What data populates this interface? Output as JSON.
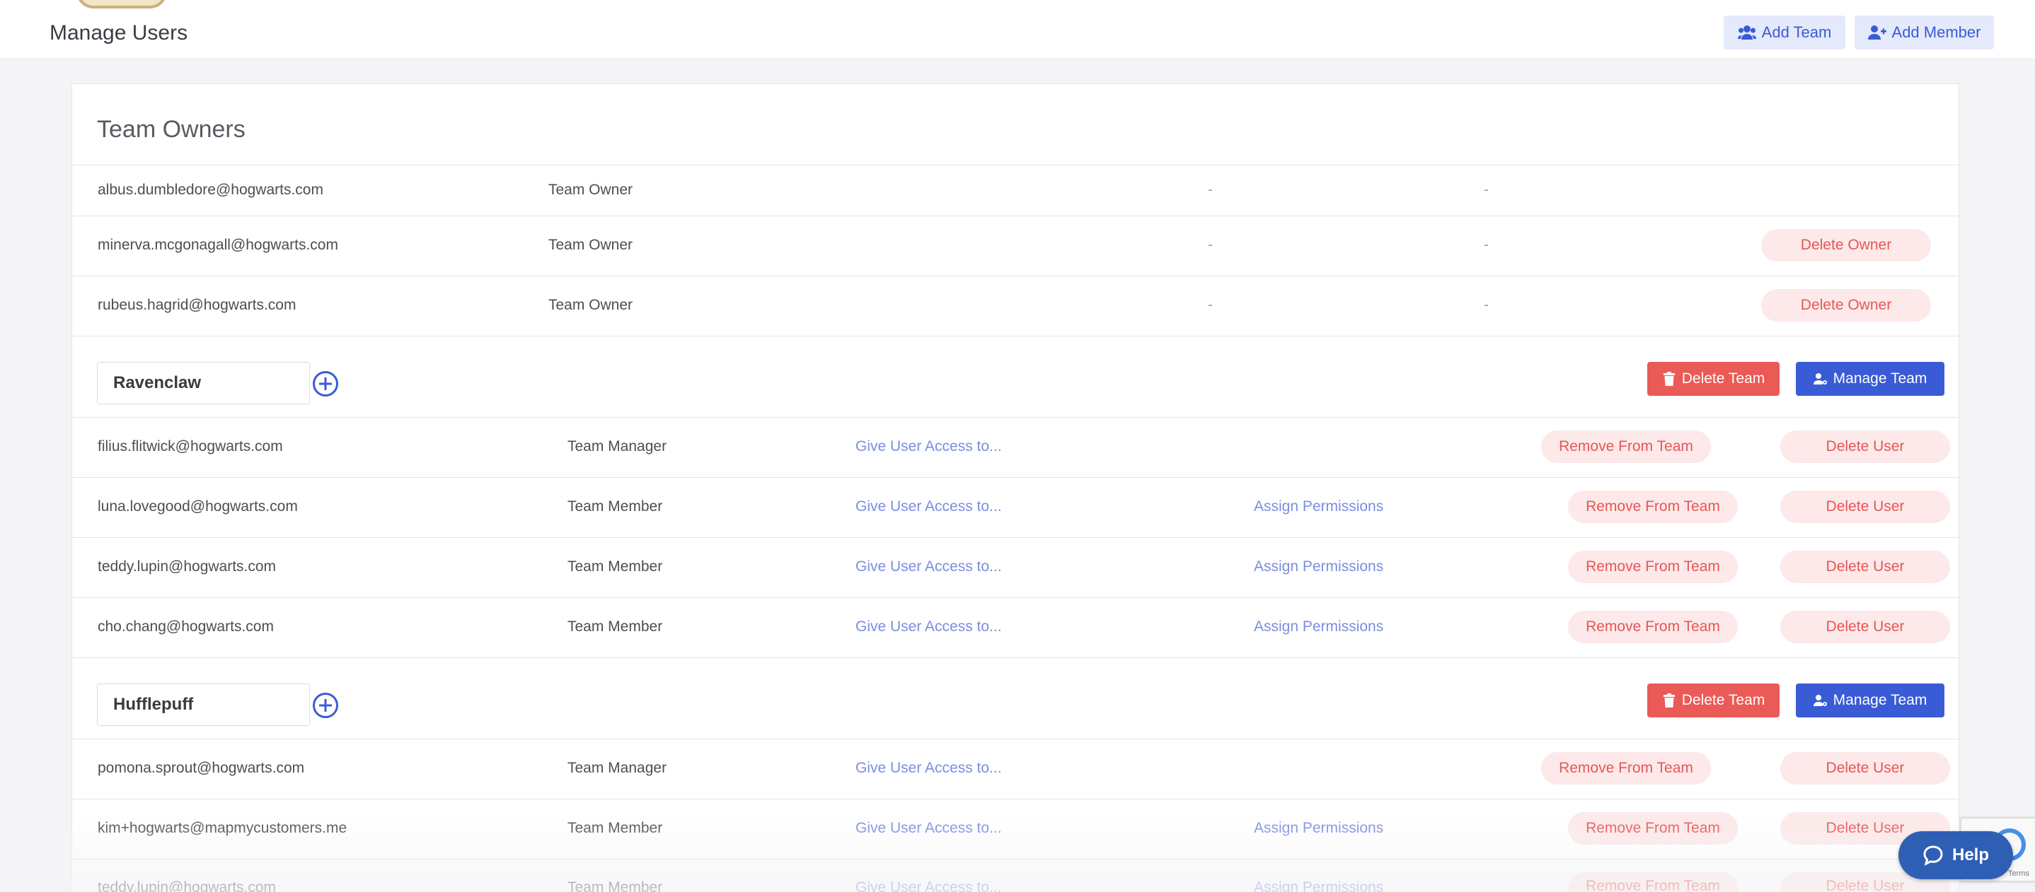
{
  "header": {
    "title": "Manage Users",
    "add_team_label": "Add Team",
    "add_member_label": "Add Member"
  },
  "owners_section": {
    "title": "Team Owners",
    "rows": [
      {
        "email": "albus.dumbledore@hogwarts.com",
        "role": "Team Owner",
        "col3": "-",
        "col4": "-",
        "action": ""
      },
      {
        "email": "minerva.mcgonagall@hogwarts.com",
        "role": "Team Owner",
        "col3": "-",
        "col4": "-",
        "action": "Delete Owner"
      },
      {
        "email": "rubeus.hagrid@hogwarts.com",
        "role": "Team Owner",
        "col3": "-",
        "col4": "-",
        "action": "Delete Owner"
      }
    ]
  },
  "teams": [
    {
      "name": "Ravenclaw",
      "delete_team_label": "Delete Team",
      "manage_team_label": "Manage Team",
      "members": [
        {
          "email": "filius.flitwick@hogwarts.com",
          "role": "Team Manager",
          "access": "Give User Access to...",
          "permissions": "",
          "remove": "Remove From Team",
          "delete": "Delete User"
        },
        {
          "email": "luna.lovegood@hogwarts.com",
          "role": "Team Member",
          "access": "Give User Access to...",
          "permissions": "Assign Permissions",
          "remove": "Remove From Team",
          "delete": "Delete User"
        },
        {
          "email": "teddy.lupin@hogwarts.com",
          "role": "Team Member",
          "access": "Give User Access to...",
          "permissions": "Assign Permissions",
          "remove": "Remove From Team",
          "delete": "Delete User"
        },
        {
          "email": "cho.chang@hogwarts.com",
          "role": "Team Member",
          "access": "Give User Access to...",
          "permissions": "Assign Permissions",
          "remove": "Remove From Team",
          "delete": "Delete User"
        }
      ]
    },
    {
      "name": "Hufflepuff",
      "delete_team_label": "Delete Team",
      "manage_team_label": "Manage Team",
      "members": [
        {
          "email": "pomona.sprout@hogwarts.com",
          "role": "Team Manager",
          "access": "Give User Access to...",
          "permissions": "",
          "remove": "Remove From Team",
          "delete": "Delete User"
        },
        {
          "email": "kim+hogwarts@mapmycustomers.me",
          "role": "Team Member",
          "access": "Give User Access to...",
          "permissions": "Assign Permissions",
          "remove": "Remove From Team",
          "delete": "Delete User"
        },
        {
          "email": "teddy.lupin@hogwarts.com",
          "role": "Team Member",
          "access": "Give User Access to...",
          "permissions": "Assign Permissions",
          "remove": "Remove From Team",
          "delete": "Delete User"
        }
      ]
    }
  ],
  "help_widget": {
    "label": "Help"
  },
  "recaptcha": {
    "text": "Terms"
  },
  "colors": {
    "accent": "#3a5bd6",
    "danger": "#ea5a56",
    "danger_soft": "#fde9e9",
    "link": "#7a8ee0",
    "help": "#2f5fb4"
  },
  "icons": {
    "add_team": "users-icon",
    "add_member": "user-plus-icon",
    "delete_team": "trash-icon",
    "manage_team": "users-cog-icon",
    "add_to_team": "plus-circle-icon",
    "help": "chat-bubble-icon"
  }
}
